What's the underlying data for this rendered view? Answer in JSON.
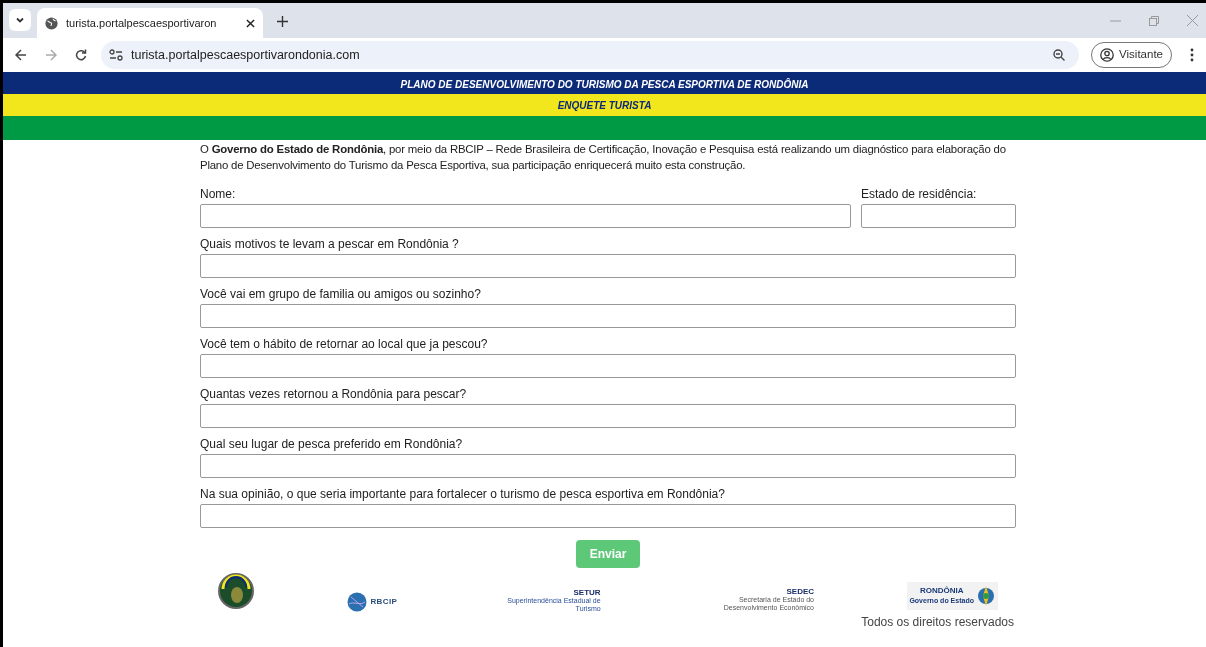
{
  "browser": {
    "tab_title": "turista.portalpescaesportivaron",
    "url": "turista.portalpescaesportivarondonia.com",
    "profile": "Visitante"
  },
  "banner": {
    "title": "PLANO DE DESENVOLVIMENTO DO TURISMO DA PESCA ESPORTIVA DE RONDÔNIA",
    "subtitle": "ENQUETE TURISTA"
  },
  "intro": "O **Governo do Estado de Rondônia**, por meio da RBCIP – Rede Brasileira de Certificação, Inovação e Pesquisa está realizando um diagnóstico para elaboração do Plano de Desenvolvimento do Turismo da Pesca Esportiva, sua participação enriquecerá muito esta construção.",
  "form": {
    "rows": [
      {
        "fields": [
          {
            "label": "Nome:"
          },
          {
            "label": "Estado de residência:"
          }
        ]
      },
      {
        "fields": [
          {
            "label": "Quais motivos te levam a pescar em Rondônia ?"
          }
        ]
      },
      {
        "fields": [
          {
            "label": "Você vai em grupo de familia ou amigos ou sozinho?"
          }
        ]
      },
      {
        "fields": [
          {
            "label": "Você tem o hábito de retornar ao local que ja pescou?"
          }
        ]
      },
      {
        "fields": [
          {
            "label": "Quantas vezes retornou a Rondônia para pescar?"
          }
        ]
      },
      {
        "fields": [
          {
            "label": "Qual seu lugar de pesca preferido em Rondônia?"
          }
        ]
      },
      {
        "fields": [
          {
            "label": "Na sua opinião, o que seria importante para fortalecer o turismo de pesca esportiva em Rondônia?"
          }
        ]
      }
    ],
    "submit": "Enviar"
  },
  "logos": [
    {
      "kind": "seal"
    },
    {
      "kind": "rbcip",
      "name": "RBCIP"
    },
    {
      "kind": "setur",
      "name": "SETUR",
      "caption": "Superintendência Estadual de Turismo"
    },
    {
      "kind": "sedec",
      "name": "SEDEC",
      "caption": "Secretaria de Estado do Desenvolvimento Econômico"
    },
    {
      "kind": "rondonia",
      "name": "RONDÔNIA",
      "caption": "Governo do Estado"
    }
  ],
  "footer": "Todos os direitos reservados"
}
